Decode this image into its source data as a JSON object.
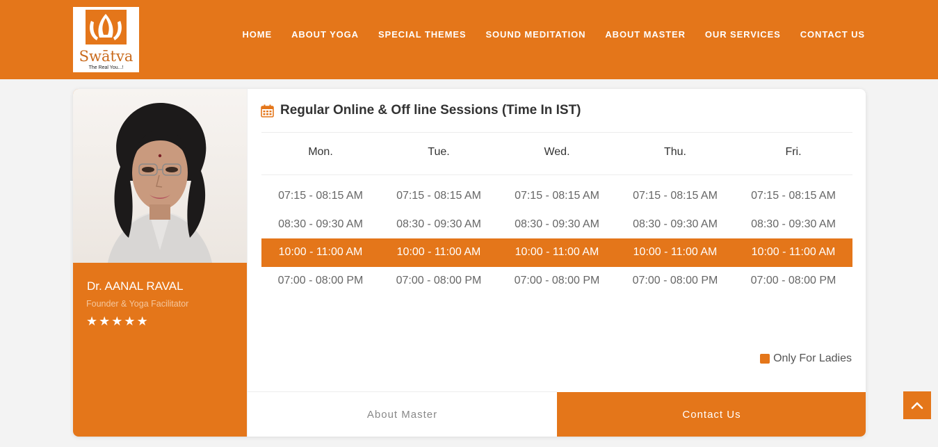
{
  "brand": {
    "name": "Swātva",
    "tagline": "The Real You...!"
  },
  "nav": {
    "items": [
      {
        "label": "HOME"
      },
      {
        "label": "ABOUT YOGA"
      },
      {
        "label": "SPECIAL THEMES"
      },
      {
        "label": "SOUND MEDITATION"
      },
      {
        "label": "ABOUT MASTER"
      },
      {
        "label": "OUR SERVICES"
      },
      {
        "label": "CONTACT US"
      }
    ]
  },
  "master": {
    "name": "Dr. AANAL RAVAL",
    "role": "Founder & Yoga Facilitator",
    "rating": 5
  },
  "schedule": {
    "title": "Regular Online & Off line Sessions (Time In IST)",
    "icon": "calendar-icon",
    "days": [
      "Mon.",
      "Tue.",
      "Wed.",
      "Thu.",
      "Fri."
    ],
    "rows": [
      {
        "slot": "07:15 - 08:15 AM",
        "ladies_only": false
      },
      {
        "slot": "08:30 - 09:30 AM",
        "ladies_only": false
      },
      {
        "slot": "10:00 - 11:00 AM",
        "ladies_only": true
      },
      {
        "slot": "07:00 - 08:00 PM",
        "ladies_only": false
      }
    ],
    "legend": "Only For Ladies"
  },
  "buttons": {
    "about": "About Master",
    "contact": "Contact Us"
  },
  "colors": {
    "accent": "#e4761a"
  }
}
